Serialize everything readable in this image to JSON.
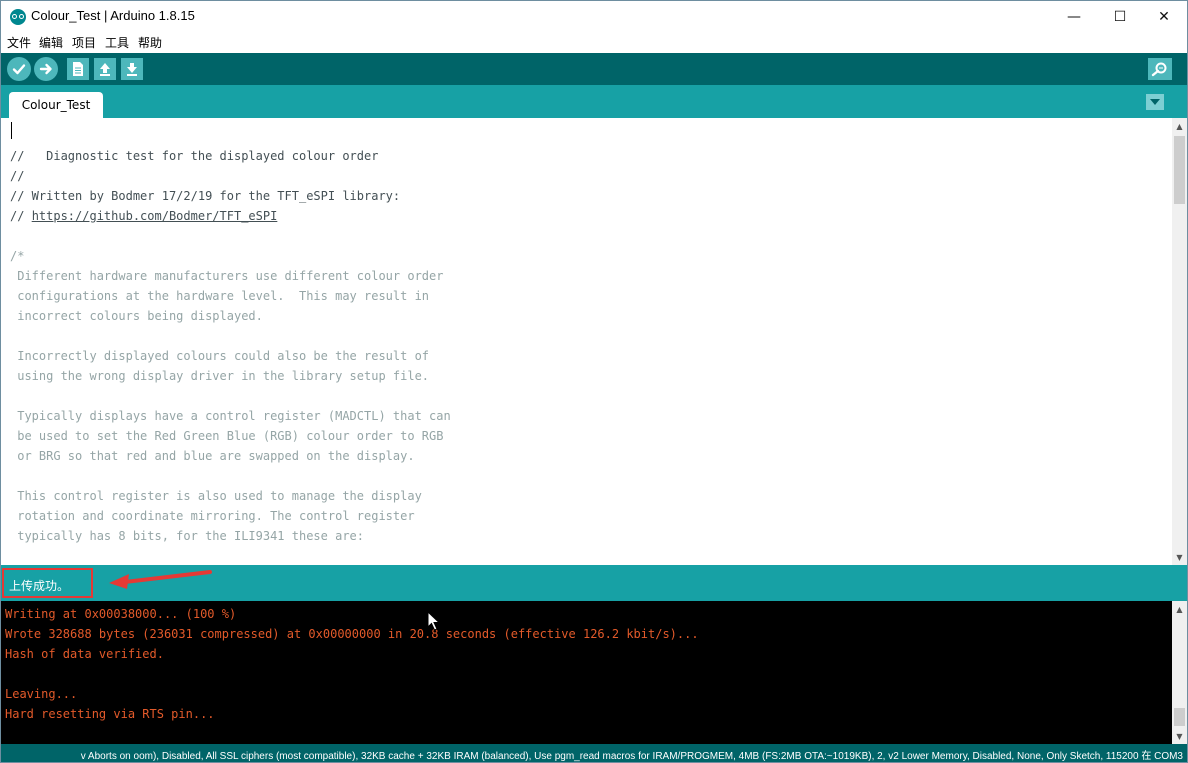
{
  "window": {
    "title": "Colour_Test | Arduino 1.8.15",
    "minimize_glyph": "—",
    "maximize_glyph": "☐",
    "close_glyph": "✕"
  },
  "menu": [
    "文件",
    "编辑",
    "项目",
    "工具",
    "帮助"
  ],
  "toolbar": {
    "buttons": [
      {
        "name": "verify-button",
        "icon": "check-icon"
      },
      {
        "name": "upload-button",
        "icon": "arrow-right-icon"
      },
      {
        "name": "new-button",
        "icon": "document-icon"
      },
      {
        "name": "open-button",
        "icon": "arrow-up-icon"
      },
      {
        "name": "save-button",
        "icon": "arrow-down-icon"
      }
    ],
    "serial_monitor_icon": "magnifier-icon"
  },
  "tabs": [
    {
      "label": "Colour_Test"
    }
  ],
  "editor": {
    "lines": [
      {
        "text": "",
        "kind": "code"
      },
      {
        "text": "//   Diagnostic test for the displayed colour order",
        "kind": "comment"
      },
      {
        "text": "//",
        "kind": "comment"
      },
      {
        "text": "// Written by Bodmer 17/2/19 for the TFT_eSPI library:",
        "kind": "comment"
      },
      {
        "text": "// ",
        "kind": "comment",
        "link": "https://github.com/Bodmer/TFT_eSPI"
      },
      {
        "text": "",
        "kind": "code"
      },
      {
        "text": "/*",
        "kind": "block"
      },
      {
        "text": " Different hardware manufacturers use different colour order",
        "kind": "block"
      },
      {
        "text": " configurations at the hardware level.  This may result in",
        "kind": "block"
      },
      {
        "text": " incorrect colours being displayed.",
        "kind": "block"
      },
      {
        "text": "",
        "kind": "block"
      },
      {
        "text": " Incorrectly displayed colours could also be the result of",
        "kind": "block"
      },
      {
        "text": " using the wrong display driver in the library setup file.",
        "kind": "block"
      },
      {
        "text": "",
        "kind": "block"
      },
      {
        "text": " Typically displays have a control register (MADCTL) that can",
        "kind": "block"
      },
      {
        "text": " be used to set the Red Green Blue (RGB) colour order to RGB",
        "kind": "block"
      },
      {
        "text": " or BRG so that red and blue are swapped on the display.",
        "kind": "block"
      },
      {
        "text": "",
        "kind": "block"
      },
      {
        "text": " This control register is also used to manage the display",
        "kind": "block"
      },
      {
        "text": " rotation and coordinate mirroring. The control register",
        "kind": "block"
      },
      {
        "text": " typically has 8 bits, for the ILI9341 these are:",
        "kind": "block"
      },
      {
        "text": "",
        "kind": "block"
      }
    ]
  },
  "status": {
    "message": "上传成功。"
  },
  "console": {
    "lines": [
      "Writing at 0x00038000... (100 %)",
      "Wrote 328688 bytes (236031 compressed) at 0x00000000 in 20.8 seconds (effective 126.2 kbit/s)...",
      "Hash of data verified.",
      "",
      "Leaving...",
      "Hard resetting via RTS pin..."
    ]
  },
  "board_info": "v Aborts on oom), Disabled, All SSL ciphers (most compatible), 32KB cache + 32KB IRAM (balanced), Use pgm_read macros for IRAM/PROGMEM, 4MB (FS:2MB OTA:~1019KB), 2, v2 Lower Memory, Disabled, None, Only Sketch, 115200 在 COM3",
  "colors": {
    "toolbar": "#006468",
    "tabbar": "#17a1a5",
    "button": "#4db7bb",
    "console_text": "#e35a2a",
    "annotation": "#e53935"
  }
}
